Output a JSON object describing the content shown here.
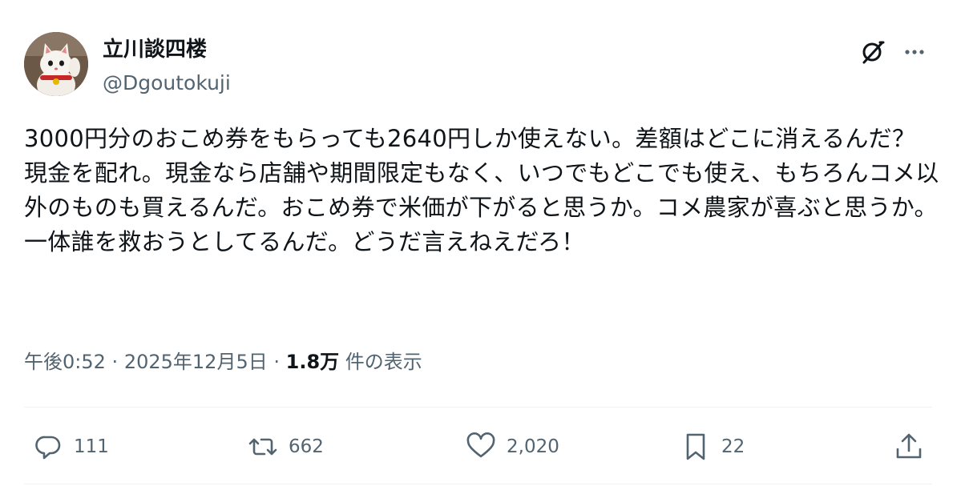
{
  "author": {
    "display_name": "立川談四楼",
    "handle": "@Dgoutokuji",
    "avatar_icon": "maneki-neko-avatar"
  },
  "header_actions": {
    "grok_icon": "grok-icon",
    "more_icon": "more-icon"
  },
  "post": {
    "text": "3000円分のおこめ券をもらっても2640円しか使えない。差額はどこに消えるんだ？ 現金を配れ。現金なら店舗や期間限定もなく、いつでもどこでも使え、もちろんコメ以外のものも買えるんだ。おこめ券で米価が下がると思うか。コメ農家が喜ぶと思うか。一体誰を救おうとしてるんだ。どうだ言えねえだろ！"
  },
  "meta": {
    "time": "午後0:52",
    "separator": "·",
    "date": "2025年12月5日",
    "views_count": "1.8万",
    "views_label": "件の表示"
  },
  "actions": {
    "reply": {
      "icon": "reply-icon",
      "count": "111"
    },
    "retweet": {
      "icon": "retweet-icon",
      "count": "662"
    },
    "like": {
      "icon": "heart-icon",
      "count": "2,020"
    },
    "bookmark": {
      "icon": "bookmark-icon",
      "count": "22"
    },
    "share": {
      "icon": "share-icon"
    }
  },
  "colors": {
    "text_primary": "#0f1419",
    "text_secondary": "#536471",
    "divider": "#eff3f4"
  }
}
